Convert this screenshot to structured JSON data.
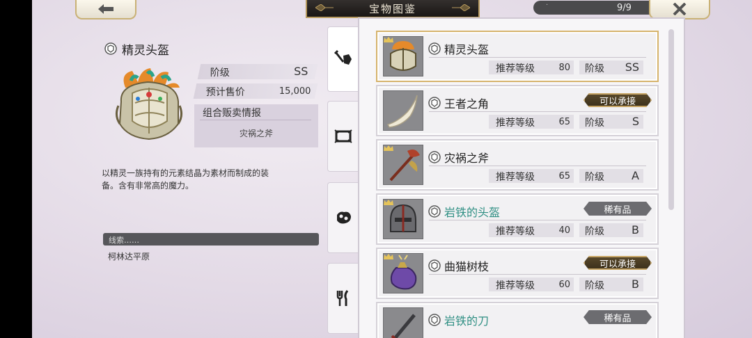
{
  "header": {
    "title": "宝物图鉴",
    "counter": "9/9",
    "counter_dot": "·",
    "back_icon": "arrow-left-icon",
    "close_icon": "close-icon"
  },
  "detail": {
    "name": "精灵头盔",
    "rank_label": "阶级",
    "rank_value": "SS",
    "price_label": "预计售价",
    "price_value": "15,000",
    "combo_title": "组合贩卖情报",
    "combo_item": "灾祸之斧",
    "description": "以精灵一族持有的元素结晶为素材而制成的装备。含有非常高的魔力。",
    "clue_label": "线索……",
    "clue_value": "柯林达平原"
  },
  "tabs": [
    {
      "icon": "weapon-armor-icon",
      "active": true
    },
    {
      "icon": "scroll-icon",
      "active": false
    },
    {
      "icon": "ore-icon",
      "active": false
    },
    {
      "icon": "utensils-icon",
      "active": false
    }
  ],
  "list": {
    "level_label": "推荐等级",
    "rank_label": "阶级",
    "items": [
      {
        "name": "精灵头盔",
        "level": "80",
        "rank": "SS",
        "badge": "",
        "rare_name": false,
        "selected": true
      },
      {
        "name": "王者之角",
        "level": "65",
        "rank": "S",
        "badge": "可以承接",
        "rare_name": false,
        "selected": false
      },
      {
        "name": "灾祸之斧",
        "level": "65",
        "rank": "A",
        "badge": "",
        "rare_name": false,
        "selected": false
      },
      {
        "name": "岩铁的头盔",
        "level": "40",
        "rank": "B",
        "badge": "稀有品",
        "rare_name": true,
        "selected": false
      },
      {
        "name": "曲猫树枝",
        "level": "60",
        "rank": "B",
        "badge": "可以承接",
        "rare_name": false,
        "selected": false
      },
      {
        "name": "岩铁的刀",
        "level": "",
        "rank": "",
        "badge": "稀有品",
        "rare_name": true,
        "selected": false
      }
    ]
  },
  "colors": {
    "gold_border": "#d6b36b",
    "rare_text": "#2f8f83",
    "title_bg": "#191614"
  }
}
